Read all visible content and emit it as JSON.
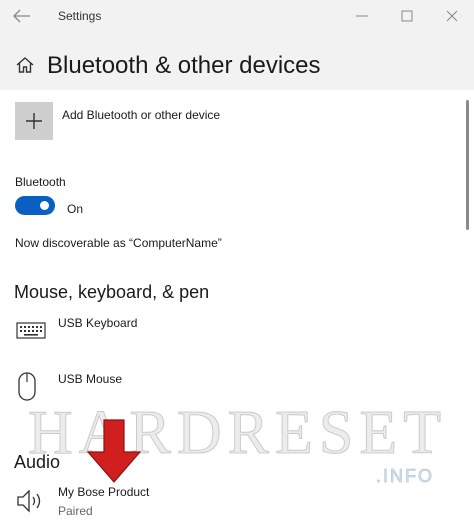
{
  "window": {
    "title": "Settings"
  },
  "header": {
    "page_title": "Bluetooth & other devices"
  },
  "add_device": {
    "label": "Add Bluetooth or other device"
  },
  "bluetooth": {
    "label": "Bluetooth",
    "state": "On",
    "enabled": true,
    "discoverable_text": "Now discoverable as “ComputerName”"
  },
  "mouse_section": {
    "title": "Mouse, keyboard, & pen",
    "devices": [
      {
        "name": "USB Keyboard",
        "icon": "keyboard-icon"
      },
      {
        "name": "USB Mouse",
        "icon": "mouse-icon"
      }
    ]
  },
  "audio_section": {
    "title": "Audio",
    "devices": [
      {
        "name": "My Bose Product",
        "status": "Paired",
        "icon": "speaker-icon"
      }
    ]
  },
  "watermark": {
    "text": "HARDRESET",
    "sub": ".INFO"
  },
  "colors": {
    "accent": "#0a5fc2",
    "chrome": "#f2f2f2",
    "arrow": "#d11f1f"
  }
}
